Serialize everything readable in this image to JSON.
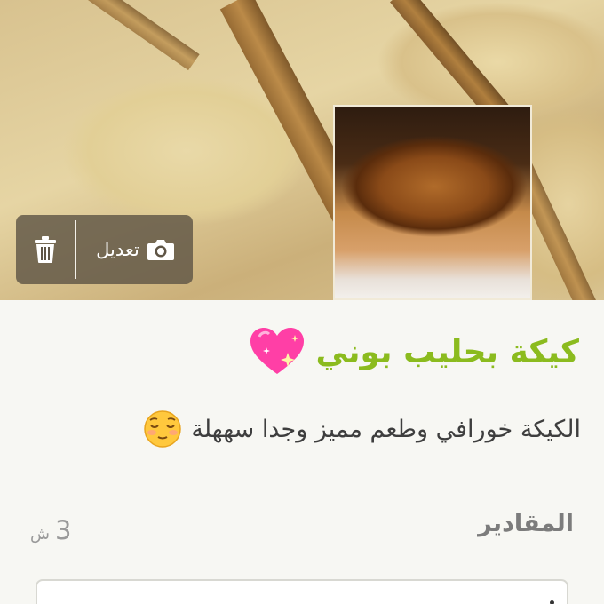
{
  "hero": {
    "photo_alt": "cake slices",
    "inset_alt": "whole cake"
  },
  "actions": {
    "edit_label": "تعديل",
    "edit_icon": "camera-icon",
    "delete_icon": "trash-icon"
  },
  "recipe": {
    "title": "كيكة بحليب بوني",
    "title_emoji": "💖",
    "title_color": "#8bbb1e",
    "description": "الكيكة خورافي وطعم مميز وجدا سههلة",
    "description_emoji": "😌"
  },
  "ingredients": {
    "label": "المقادير",
    "servings_value": "3",
    "servings_unit": "ش"
  }
}
